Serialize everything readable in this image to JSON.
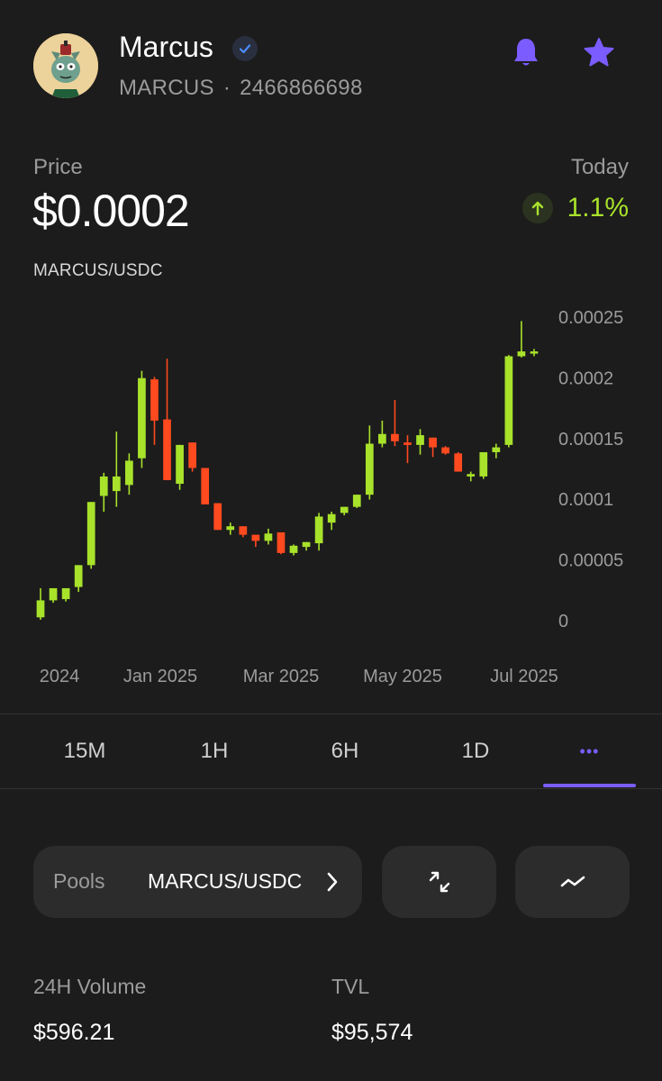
{
  "token": {
    "name": "Marcus",
    "symbol": "MARCUS",
    "separator": "·",
    "id": "2466866698",
    "verified": true,
    "icons": {
      "verified": "verified-check-icon",
      "notify": "bell-icon",
      "favorite": "star-icon"
    }
  },
  "price": {
    "label": "Price",
    "value": "$0.0002",
    "period_label": "Today",
    "change": "1.1%",
    "direction": "up"
  },
  "pair": "MARCUS/USDC",
  "colors": {
    "accent": "#7a5cff",
    "up": "#a8e22b",
    "down": "#ff4a1f",
    "background": "#1c1c1c"
  },
  "chart_data": {
    "type": "candlestick",
    "x_tick_labels": [
      "2024",
      "Jan 2025",
      "Mar 2025",
      "May 2025",
      "Jul 2025"
    ],
    "y_tick_labels": [
      "0.00025",
      "0.0002",
      "0.00015",
      "0.0001",
      "0.00005",
      "0"
    ],
    "ylim": [
      0,
      0.00025
    ],
    "grid": false,
    "candles": [
      {
        "o": 2e-06,
        "h": 2.6e-05,
        "l": 0.0,
        "c": 1.6e-05
      },
      {
        "o": 1.6e-05,
        "h": 2.6e-05,
        "l": 1.4e-05,
        "c": 2.6e-05
      },
      {
        "o": 1.7e-05,
        "h": 2.2e-05,
        "l": 1.5e-05,
        "c": 2.6e-05
      },
      {
        "o": 2.7e-05,
        "h": 4.5e-05,
        "l": 2.3e-05,
        "c": 4.5e-05
      },
      {
        "o": 4.5e-05,
        "h": 9.7e-05,
        "l": 4.2e-05,
        "c": 9.7e-05
      },
      {
        "o": 0.000102,
        "h": 0.000121,
        "l": 8.9e-05,
        "c": 0.000118
      },
      {
        "o": 0.000106,
        "h": 0.000155,
        "l": 9.3e-05,
        "c": 0.000118
      },
      {
        "o": 0.000111,
        "h": 0.000137,
        "l": 0.000103,
        "c": 0.000131
      },
      {
        "o": 0.000133,
        "h": 0.000205,
        "l": 0.000125,
        "c": 0.000199
      },
      {
        "o": 0.000198,
        "h": 0.0002,
        "l": 0.000144,
        "c": 0.000164
      },
      {
        "o": 0.000165,
        "h": 0.000215,
        "l": 0.000145,
        "c": 0.000115
      },
      {
        "o": 0.000112,
        "h": 0.000144,
        "l": 0.000107,
        "c": 0.000144
      },
      {
        "o": 0.000146,
        "h": 0.000146,
        "l": 0.000122,
        "c": 0.000125
      },
      {
        "o": 0.000125,
        "h": 0.000125,
        "l": 9.5e-05,
        "c": 9.5e-05
      },
      {
        "o": 9.6e-05,
        "h": 9.6e-05,
        "l": 7.4e-05,
        "c": 7.4e-05
      },
      {
        "o": 7.4e-05,
        "h": 8e-05,
        "l": 7e-05,
        "c": 7.7e-05
      },
      {
        "o": 7.7e-05,
        "h": 7.7e-05,
        "l": 6.8e-05,
        "c": 7e-05
      },
      {
        "o": 7e-05,
        "h": 7e-05,
        "l": 6e-05,
        "c": 6.5e-05
      },
      {
        "o": 6.5e-05,
        "h": 7.5e-05,
        "l": 6.2e-05,
        "c": 7.1e-05
      },
      {
        "o": 7.2e-05,
        "h": 7.2e-05,
        "l": 5.4e-05,
        "c": 5.5e-05
      },
      {
        "o": 5.5e-05,
        "h": 6.2e-05,
        "l": 5.3e-05,
        "c": 6.1e-05
      },
      {
        "o": 6e-05,
        "h": 6.4e-05,
        "l": 5.7e-05,
        "c": 6.4e-05
      },
      {
        "o": 6.3e-05,
        "h": 8.8e-05,
        "l": 5.7e-05,
        "c": 8.5e-05
      },
      {
        "o": 8e-05,
        "h": 8.9e-05,
        "l": 7.4e-05,
        "c": 8.7e-05
      },
      {
        "o": 8.8e-05,
        "h": 9.3e-05,
        "l": 8.6e-05,
        "c": 9.3e-05
      },
      {
        "o": 9.3e-05,
        "h": 0.000103,
        "l": 9.2e-05,
        "c": 0.000103
      },
      {
        "o": 0.000103,
        "h": 0.00016,
        "l": 9.9e-05,
        "c": 0.000145
      },
      {
        "o": 0.000145,
        "h": 0.000164,
        "l": 0.000142,
        "c": 0.000153
      },
      {
        "o": 0.000153,
        "h": 0.000181,
        "l": 0.000143,
        "c": 0.000147
      },
      {
        "o": 0.000146,
        "h": 0.000152,
        "l": 0.000129,
        "c": 0.000144
      },
      {
        "o": 0.000144,
        "h": 0.000157,
        "l": 0.000136,
        "c": 0.000152
      },
      {
        "o": 0.00015,
        "h": 0.00015,
        "l": 0.000134,
        "c": 0.000142
      },
      {
        "o": 0.000142,
        "h": 0.000143,
        "l": 0.000136,
        "c": 0.000137
      },
      {
        "o": 0.000137,
        "h": 0.000138,
        "l": 0.000128,
        "c": 0.000122
      },
      {
        "o": 0.000118,
        "h": 0.000122,
        "l": 0.000114,
        "c": 0.00012
      },
      {
        "o": 0.000118,
        "h": 0.000138,
        "l": 0.000116,
        "c": 0.000138
      },
      {
        "o": 0.000138,
        "h": 0.000145,
        "l": 0.000133,
        "c": 0.000142
      },
      {
        "o": 0.000144,
        "h": 0.000218,
        "l": 0.000142,
        "c": 0.000217
      },
      {
        "o": 0.000217,
        "h": 0.000246,
        "l": 0.000216,
        "c": 0.000221
      },
      {
        "o": 0.00022,
        "h": 0.000223,
        "l": 0.000217,
        "c": 0.000221
      }
    ]
  },
  "tabs": [
    {
      "label": "15M",
      "active": false
    },
    {
      "label": "1H",
      "active": false
    },
    {
      "label": "6H",
      "active": false
    },
    {
      "label": "1D",
      "active": false
    },
    {
      "label": "•••",
      "active": true
    }
  ],
  "pools": {
    "label": "Pools",
    "pair": "MARCUS/USDC",
    "chevron_icon": "chevron-right-icon"
  },
  "action_icons": {
    "swap": "swap-arrows-icon",
    "line_chart": "trend-line-icon"
  },
  "stats": {
    "volume_label": "24H Volume",
    "volume_value": "$596.21",
    "tvl_label": "TVL",
    "tvl_value": "$95,574"
  }
}
